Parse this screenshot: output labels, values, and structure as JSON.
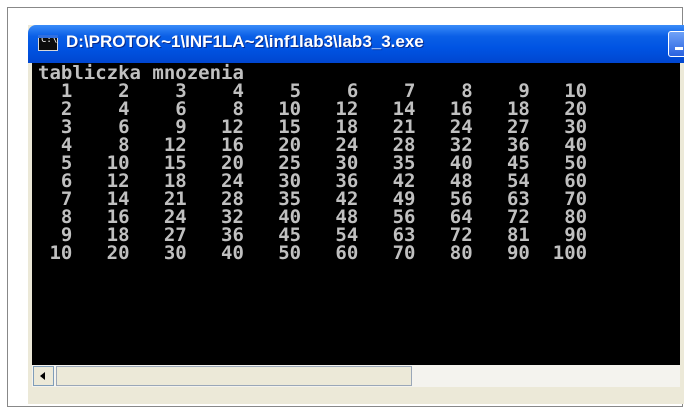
{
  "window": {
    "title": "D:\\PROTOK~1\\INF1LA~2\\inf1lab3\\lab3_3.exe",
    "icon_text": "C:\\"
  },
  "console": {
    "lines": [
      "tabliczka mnozenia",
      "  1    2    3    4    5    6    7    8    9   10",
      "  2    4    6    8   10   12   14   16   18   20",
      "  3    6    9   12   15   18   21   24   27   30",
      "  4    8   12   16   20   24   28   32   36   40",
      "  5   10   15   20   25   30   35   40   45   50",
      "  6   12   18   24   30   36   42   48   54   60",
      "  7   14   21   28   35   42   49   56   63   70",
      "  8   16   24   32   40   48   56   64   72   80",
      "  9   18   27   36   45   54   63   72   81   90",
      " 10   20   30   40   50   60   70   80   90  100"
    ]
  },
  "colors": {
    "console_bg": "#000000",
    "console_text": "#C0C0C0",
    "titlebar": "#0054E3"
  }
}
